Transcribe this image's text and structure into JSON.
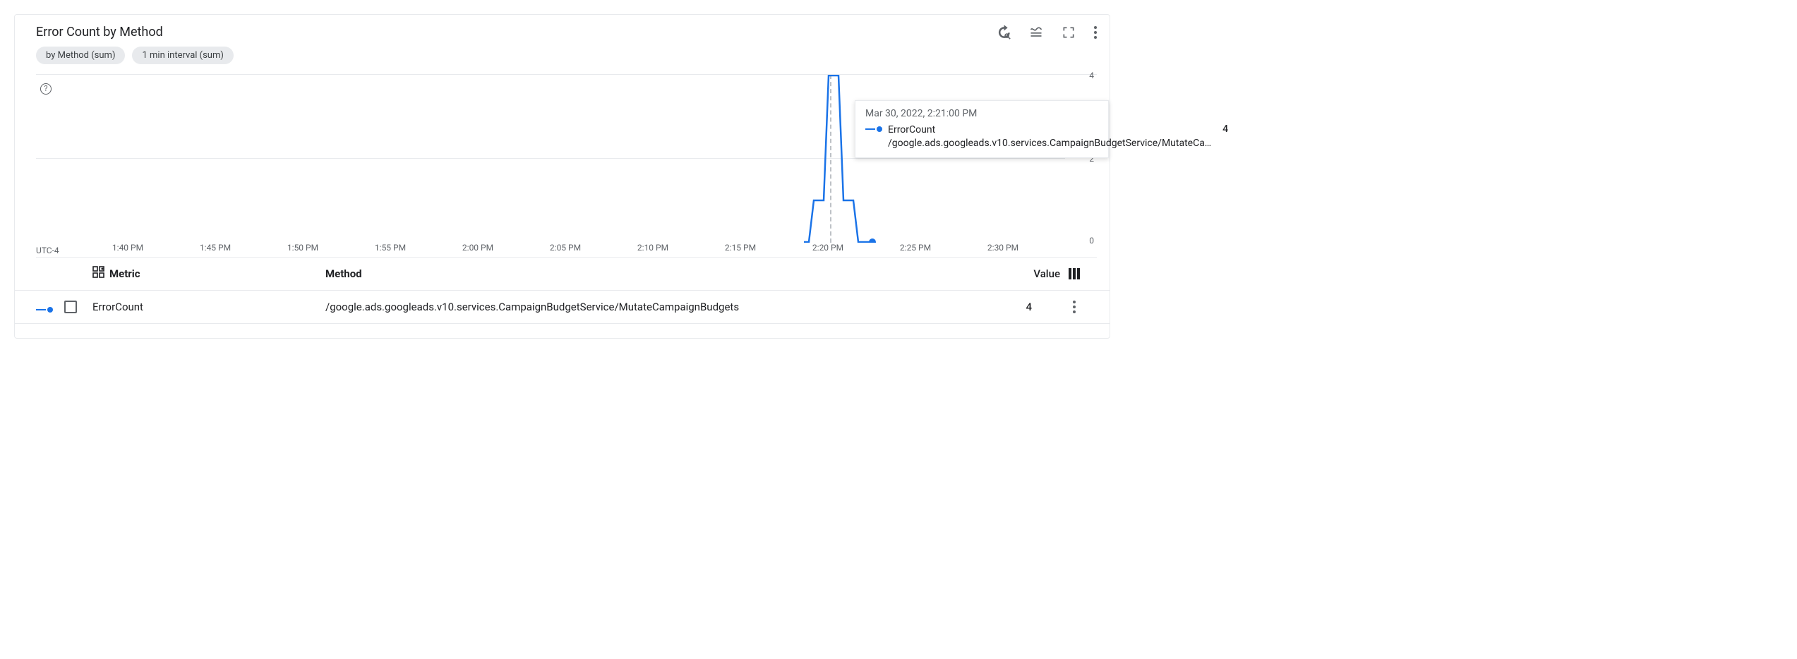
{
  "title": "Error Count by Method",
  "chips": [
    "by Method (sum)",
    "1 min interval (sum)"
  ],
  "chart_data": {
    "type": "line",
    "timezone": "UTC-4",
    "x_ticks": [
      "1:40 PM",
      "1:45 PM",
      "1:50 PM",
      "1:55 PM",
      "2:00 PM",
      "2:05 PM",
      "2:10 PM",
      "2:15 PM",
      "2:20 PM",
      "2:25 PM",
      "2:30 PM"
    ],
    "y_ticks": [
      0,
      2,
      4
    ],
    "ylim": [
      0,
      4
    ],
    "series": [
      {
        "name": "ErrorCount /google.ads.googleads.v10.services.CampaignBudgetService/MutateCampaignBudgets",
        "color": "#1a73e8",
        "points": [
          {
            "x": "2:19 PM",
            "y": 0
          },
          {
            "x": "2:20 PM",
            "y": 1
          },
          {
            "x": "2:21 PM",
            "y": 4
          },
          {
            "x": "2:22 PM",
            "y": 1
          },
          {
            "x": "2:23 PM",
            "y": 0
          }
        ]
      }
    ],
    "crosshair_x": "2:21 PM"
  },
  "tooltip": {
    "timestamp": "Mar 30, 2022, 2:21:00 PM",
    "label": "ErrorCount /google.ads.googleads.v10.services.CampaignBudgetService/MutateCa…",
    "value": "4"
  },
  "legend": {
    "headers": {
      "metric": "Metric",
      "method": "Method",
      "value": "Value"
    },
    "rows": [
      {
        "metric": "ErrorCount",
        "method": "/google.ads.googleads.v10.services.CampaignBudgetService/MutateCampaignBudgets",
        "value": "4",
        "color": "#1a73e8"
      }
    ]
  }
}
